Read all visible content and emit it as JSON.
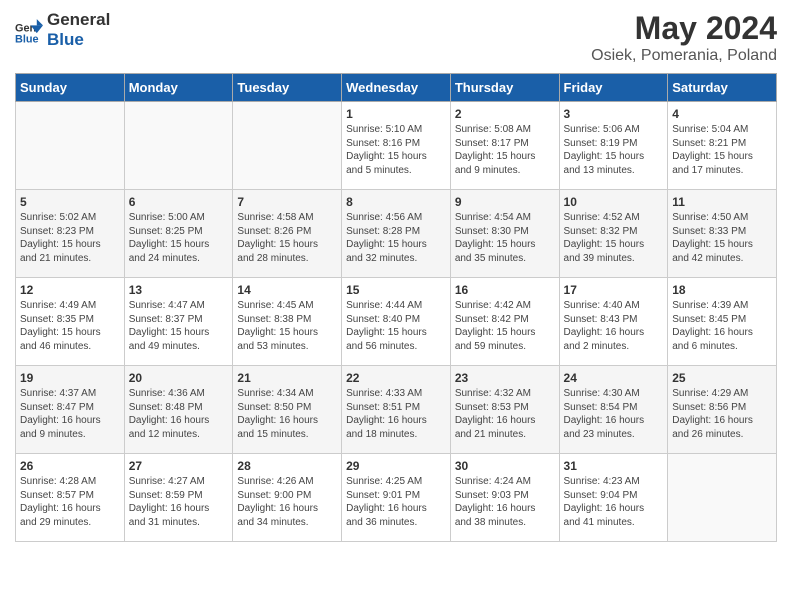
{
  "header": {
    "logo_line1": "General",
    "logo_line2": "Blue",
    "title": "May 2024",
    "subtitle": "Osiek, Pomerania, Poland"
  },
  "weekdays": [
    "Sunday",
    "Monday",
    "Tuesday",
    "Wednesday",
    "Thursday",
    "Friday",
    "Saturday"
  ],
  "weeks": [
    [
      {
        "day": "",
        "text": ""
      },
      {
        "day": "",
        "text": ""
      },
      {
        "day": "",
        "text": ""
      },
      {
        "day": "1",
        "text": "Sunrise: 5:10 AM\nSunset: 8:16 PM\nDaylight: 15 hours\nand 5 minutes."
      },
      {
        "day": "2",
        "text": "Sunrise: 5:08 AM\nSunset: 8:17 PM\nDaylight: 15 hours\nand 9 minutes."
      },
      {
        "day": "3",
        "text": "Sunrise: 5:06 AM\nSunset: 8:19 PM\nDaylight: 15 hours\nand 13 minutes."
      },
      {
        "day": "4",
        "text": "Sunrise: 5:04 AM\nSunset: 8:21 PM\nDaylight: 15 hours\nand 17 minutes."
      }
    ],
    [
      {
        "day": "5",
        "text": "Sunrise: 5:02 AM\nSunset: 8:23 PM\nDaylight: 15 hours\nand 21 minutes."
      },
      {
        "day": "6",
        "text": "Sunrise: 5:00 AM\nSunset: 8:25 PM\nDaylight: 15 hours\nand 24 minutes."
      },
      {
        "day": "7",
        "text": "Sunrise: 4:58 AM\nSunset: 8:26 PM\nDaylight: 15 hours\nand 28 minutes."
      },
      {
        "day": "8",
        "text": "Sunrise: 4:56 AM\nSunset: 8:28 PM\nDaylight: 15 hours\nand 32 minutes."
      },
      {
        "day": "9",
        "text": "Sunrise: 4:54 AM\nSunset: 8:30 PM\nDaylight: 15 hours\nand 35 minutes."
      },
      {
        "day": "10",
        "text": "Sunrise: 4:52 AM\nSunset: 8:32 PM\nDaylight: 15 hours\nand 39 minutes."
      },
      {
        "day": "11",
        "text": "Sunrise: 4:50 AM\nSunset: 8:33 PM\nDaylight: 15 hours\nand 42 minutes."
      }
    ],
    [
      {
        "day": "12",
        "text": "Sunrise: 4:49 AM\nSunset: 8:35 PM\nDaylight: 15 hours\nand 46 minutes."
      },
      {
        "day": "13",
        "text": "Sunrise: 4:47 AM\nSunset: 8:37 PM\nDaylight: 15 hours\nand 49 minutes."
      },
      {
        "day": "14",
        "text": "Sunrise: 4:45 AM\nSunset: 8:38 PM\nDaylight: 15 hours\nand 53 minutes."
      },
      {
        "day": "15",
        "text": "Sunrise: 4:44 AM\nSunset: 8:40 PM\nDaylight: 15 hours\nand 56 minutes."
      },
      {
        "day": "16",
        "text": "Sunrise: 4:42 AM\nSunset: 8:42 PM\nDaylight: 15 hours\nand 59 minutes."
      },
      {
        "day": "17",
        "text": "Sunrise: 4:40 AM\nSunset: 8:43 PM\nDaylight: 16 hours\nand 2 minutes."
      },
      {
        "day": "18",
        "text": "Sunrise: 4:39 AM\nSunset: 8:45 PM\nDaylight: 16 hours\nand 6 minutes."
      }
    ],
    [
      {
        "day": "19",
        "text": "Sunrise: 4:37 AM\nSunset: 8:47 PM\nDaylight: 16 hours\nand 9 minutes."
      },
      {
        "day": "20",
        "text": "Sunrise: 4:36 AM\nSunset: 8:48 PM\nDaylight: 16 hours\nand 12 minutes."
      },
      {
        "day": "21",
        "text": "Sunrise: 4:34 AM\nSunset: 8:50 PM\nDaylight: 16 hours\nand 15 minutes."
      },
      {
        "day": "22",
        "text": "Sunrise: 4:33 AM\nSunset: 8:51 PM\nDaylight: 16 hours\nand 18 minutes."
      },
      {
        "day": "23",
        "text": "Sunrise: 4:32 AM\nSunset: 8:53 PM\nDaylight: 16 hours\nand 21 minutes."
      },
      {
        "day": "24",
        "text": "Sunrise: 4:30 AM\nSunset: 8:54 PM\nDaylight: 16 hours\nand 23 minutes."
      },
      {
        "day": "25",
        "text": "Sunrise: 4:29 AM\nSunset: 8:56 PM\nDaylight: 16 hours\nand 26 minutes."
      }
    ],
    [
      {
        "day": "26",
        "text": "Sunrise: 4:28 AM\nSunset: 8:57 PM\nDaylight: 16 hours\nand 29 minutes."
      },
      {
        "day": "27",
        "text": "Sunrise: 4:27 AM\nSunset: 8:59 PM\nDaylight: 16 hours\nand 31 minutes."
      },
      {
        "day": "28",
        "text": "Sunrise: 4:26 AM\nSunset: 9:00 PM\nDaylight: 16 hours\nand 34 minutes."
      },
      {
        "day": "29",
        "text": "Sunrise: 4:25 AM\nSunset: 9:01 PM\nDaylight: 16 hours\nand 36 minutes."
      },
      {
        "day": "30",
        "text": "Sunrise: 4:24 AM\nSunset: 9:03 PM\nDaylight: 16 hours\nand 38 minutes."
      },
      {
        "day": "31",
        "text": "Sunrise: 4:23 AM\nSunset: 9:04 PM\nDaylight: 16 hours\nand 41 minutes."
      },
      {
        "day": "",
        "text": ""
      }
    ]
  ]
}
